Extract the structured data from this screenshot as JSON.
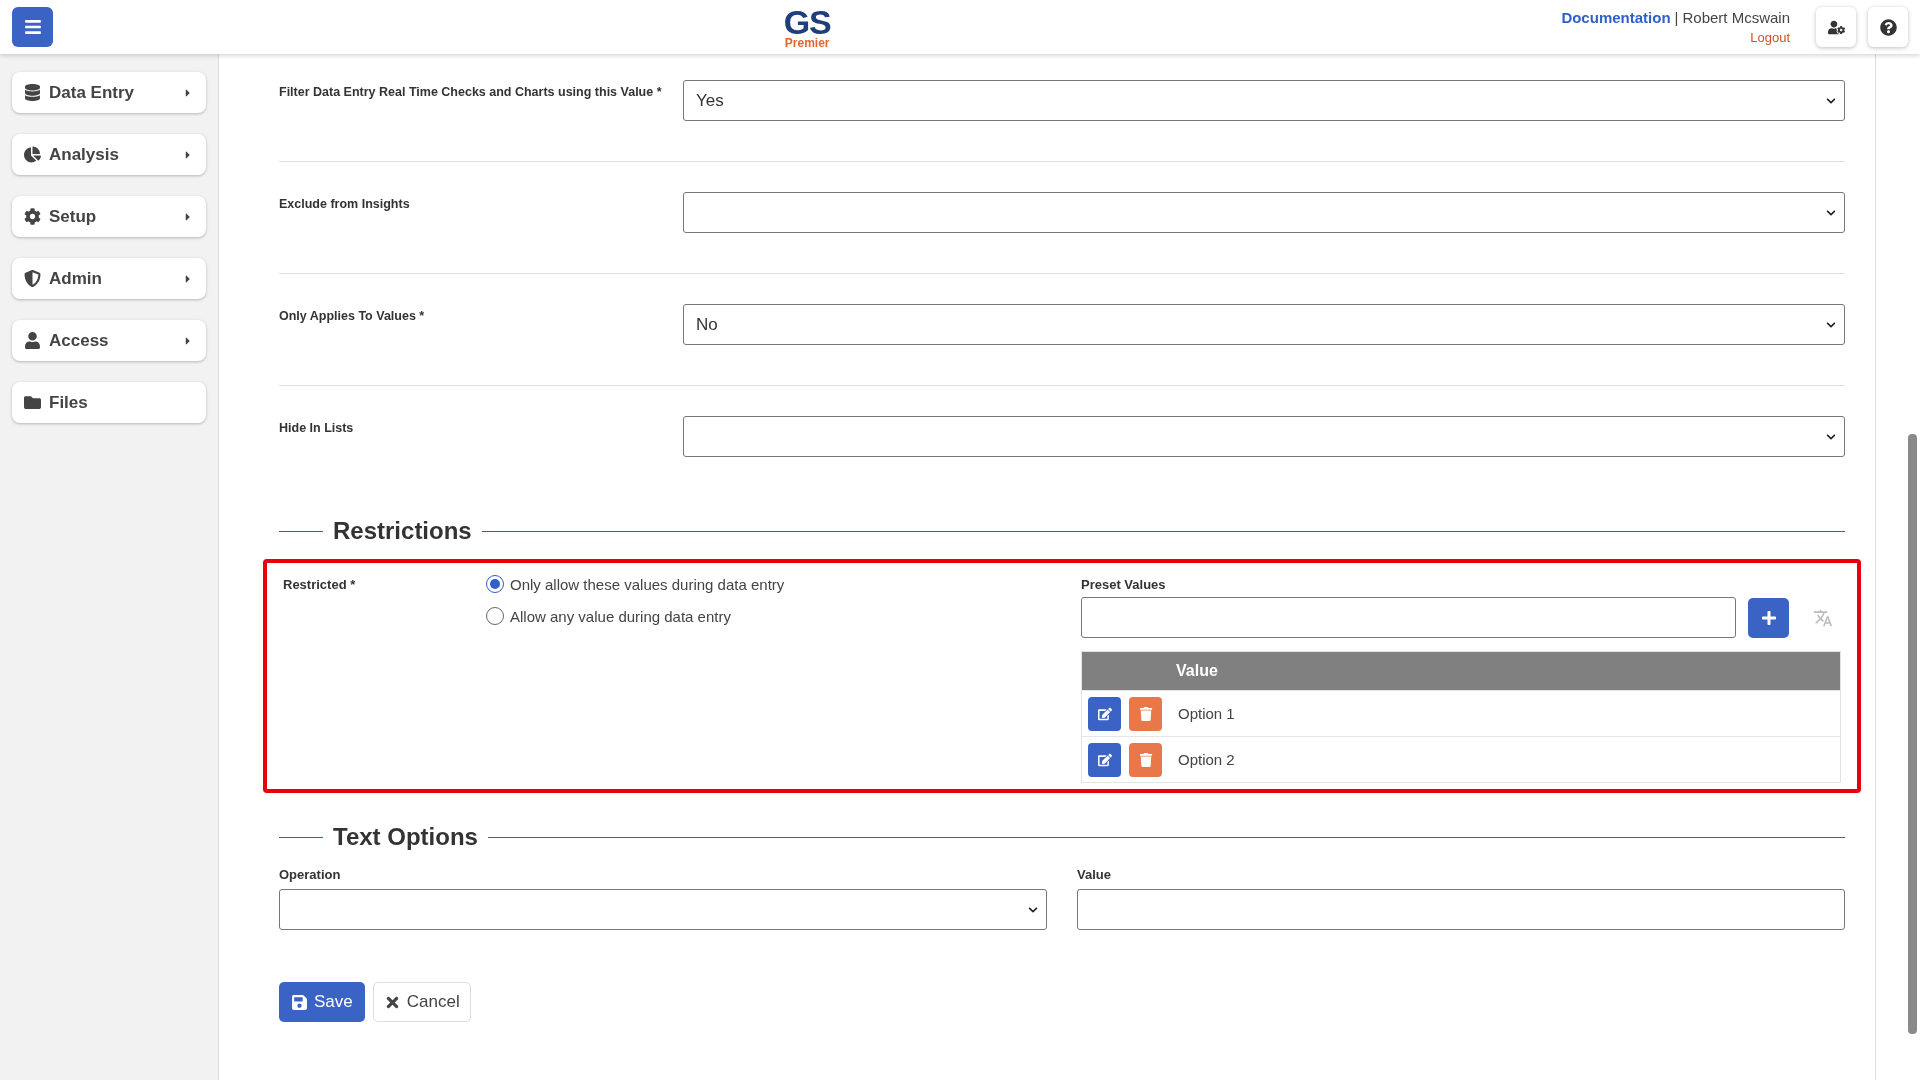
{
  "header": {
    "logo": {
      "title": "GS",
      "subtitle": "Premier"
    },
    "documentation_link": "Documentation",
    "separator": "|",
    "user_name": "Robert Mcswain",
    "logout_link": "Logout"
  },
  "sidebar": {
    "items": [
      {
        "label": "Data Entry",
        "kind": "database",
        "expandable": true
      },
      {
        "label": "Analysis",
        "kind": "pie",
        "expandable": true
      },
      {
        "label": "Setup",
        "kind": "gear",
        "expandable": true
      },
      {
        "label": "Admin",
        "kind": "shield",
        "expandable": true
      },
      {
        "label": "Access",
        "kind": "user",
        "expandable": true
      },
      {
        "label": "Files",
        "kind": "folder",
        "expandable": false
      }
    ]
  },
  "fields": [
    {
      "label": "Filter Data Entry Real Time Checks and Charts using this Value *",
      "value": "Yes"
    },
    {
      "label": "Exclude from Insights"
    },
    {
      "label": "Only Applies To Values *",
      "value": "No"
    },
    {
      "label": "Hide In Lists"
    }
  ],
  "restrictions": {
    "heading": "Restrictions",
    "highlighted": true,
    "label": "Restricted *",
    "options": [
      {
        "label": "Only allow these values during data entry",
        "selected": true
      },
      {
        "label": "Allow any value during data entry",
        "selected": false
      }
    ],
    "preset_values": {
      "label": "Preset Values",
      "table": {
        "columns": [
          "Value"
        ],
        "rows": [
          "Option 1",
          "Option 2"
        ]
      }
    }
  },
  "text_options": {
    "heading": "Text Options",
    "operation_label": "Operation",
    "value_label": "Value"
  },
  "buttons": {
    "save": "Save",
    "cancel": "Cancel"
  }
}
